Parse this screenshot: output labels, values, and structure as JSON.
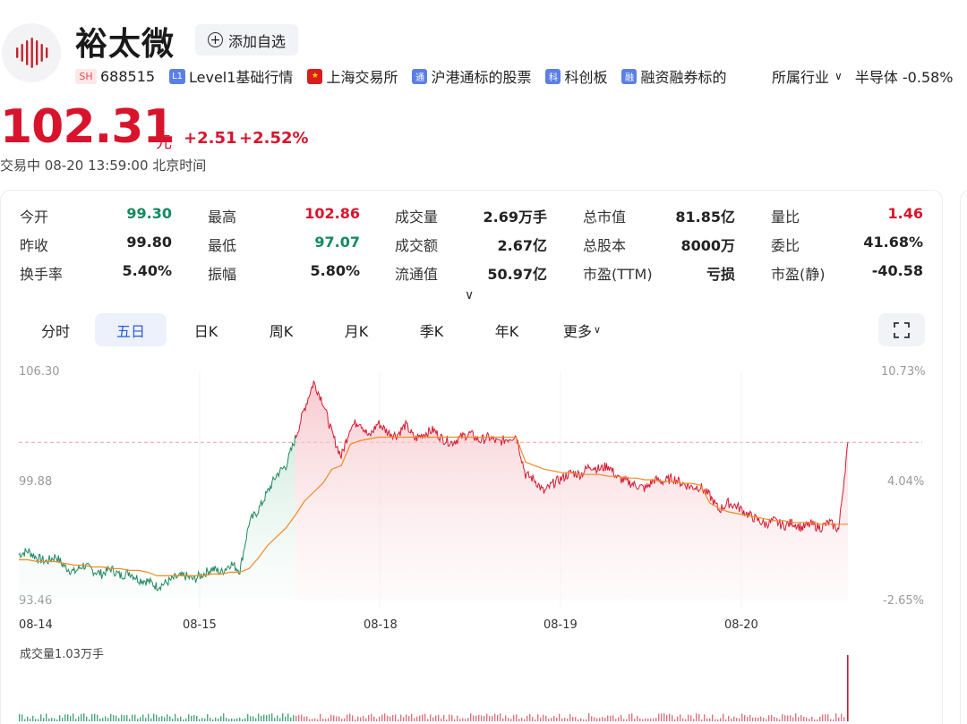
{
  "header": {
    "name": "裕太微",
    "watch_label": "添加自选",
    "tags": [
      {
        "badge": "SH",
        "text": "688515"
      },
      {
        "badge": "L1",
        "text": "Level1基础行情"
      },
      {
        "badge": "★",
        "text": "上海交易所"
      },
      {
        "badge": "通",
        "text": "沪港通标的股票"
      },
      {
        "badge": "科",
        "text": "科创板"
      },
      {
        "badge": "融",
        "text": "融资融券标的"
      }
    ],
    "industry_label": "所属行业",
    "industry_value": "半导体 -0.58%"
  },
  "quote": {
    "price": "102.31",
    "unit": "元",
    "change": "+2.51",
    "change_pct": "+2.52%",
    "status": "交易中 08-20 13:59:00 北京时间"
  },
  "stats": [
    [
      {
        "label": "今开",
        "value": "99.30",
        "tone": "down"
      },
      {
        "label": "最高",
        "value": "102.86",
        "tone": "up"
      },
      {
        "label": "成交量",
        "value": "2.69万手",
        "tone": ""
      },
      {
        "label": "总市值",
        "value": "81.85亿",
        "tone": ""
      },
      {
        "label": "量比",
        "value": "1.46",
        "tone": "up"
      }
    ],
    [
      {
        "label": "昨收",
        "value": "99.80",
        "tone": ""
      },
      {
        "label": "最低",
        "value": "97.07",
        "tone": "down"
      },
      {
        "label": "成交额",
        "value": "2.67亿",
        "tone": ""
      },
      {
        "label": "总股本",
        "value": "8000万",
        "tone": ""
      },
      {
        "label": "委比",
        "value": "41.68%",
        "tone": ""
      }
    ],
    [
      {
        "label": "换手率",
        "value": "5.40%",
        "tone": ""
      },
      {
        "label": "振幅",
        "value": "5.80%",
        "tone": ""
      },
      {
        "label": "流通值",
        "value": "50.97亿",
        "tone": ""
      },
      {
        "label": "市盈(TTM)",
        "value": "亏损",
        "tone": ""
      },
      {
        "label": "市盈(静)",
        "value": "-40.58",
        "tone": ""
      }
    ]
  ],
  "tabs": [
    "分时",
    "五日",
    "日K",
    "周K",
    "月K",
    "季K",
    "年K",
    "更多"
  ],
  "active_tab": 1,
  "chart_data": {
    "type": "line",
    "title": "",
    "x_ticks": [
      "08-14",
      "08-15",
      "08-18",
      "08-19",
      "08-20"
    ],
    "y_left_ticks": [
      "106.30",
      "99.88",
      "93.46"
    ],
    "y_right_ticks": [
      "10.73%",
      "4.04%",
      "-2.65%"
    ],
    "ylim": [
      93.46,
      106.3
    ],
    "reference_price": 102.31,
    "volume_label": "成交量1.03万手",
    "series": [
      {
        "name": "",
        "values": [
          96.0,
          96.2,
          95.8,
          95.6,
          95.9,
          95.3,
          95.0,
          95.4,
          95.1,
          94.9,
          95.2,
          94.8,
          95.0,
          94.6,
          94.5,
          94.2,
          94.4,
          94.7,
          94.8,
          94.6,
          94.9,
          95.2,
          95.0,
          95.5,
          95.1,
          97.8,
          98.5,
          99.5,
          100.5,
          101.0,
          102.5,
          104.2,
          105.7,
          104.6,
          102.8,
          101.5,
          103.2,
          103.5,
          102.6,
          103.4,
          102.9,
          102.7,
          103.3,
          102.5,
          102.8,
          103.0,
          102.5,
          102.3,
          102.6,
          102.8,
          102.4,
          102.6,
          102.3,
          102.5,
          102.7,
          100.5,
          100.2,
          99.5,
          100.0,
          100.3,
          100.6,
          100.5,
          101.0,
          100.8,
          101.0,
          100.3,
          100.1,
          99.9,
          99.7,
          100.2,
          100.1,
          100.3,
          100.0,
          99.8,
          99.8,
          99.3,
          98.5,
          98.9,
          98.7,
          98.3,
          98.0,
          97.7,
          97.9,
          97.6,
          97.8,
          97.5,
          97.7,
          97.5,
          97.8,
          97.4,
          102.31
        ]
      },
      {
        "name": "",
        "values": [
          95.7,
          95.7,
          95.6,
          95.6,
          95.6,
          95.5,
          95.4,
          95.4,
          95.3,
          95.3,
          95.2,
          95.2,
          95.1,
          95.1,
          95.0,
          94.8,
          94.8,
          94.8,
          94.8,
          94.8,
          94.8,
          94.9,
          94.9,
          95.0,
          95.0,
          95.2,
          95.8,
          96.5,
          97.0,
          97.5,
          98.2,
          99.0,
          99.5,
          100.0,
          100.8,
          101.0,
          102.2,
          102.4,
          102.5,
          102.6,
          102.6,
          102.6,
          102.6,
          102.6,
          102.6,
          102.6,
          102.6,
          102.6,
          102.6,
          102.6,
          102.6,
          102.6,
          102.6,
          102.6,
          102.6,
          101.2,
          101.0,
          100.8,
          100.7,
          100.6,
          100.6,
          100.5,
          100.5,
          100.5,
          100.4,
          100.4,
          100.3,
          100.3,
          100.2,
          100.2,
          100.1,
          100.1,
          100.0,
          100.0,
          99.9,
          98.9,
          98.6,
          98.4,
          98.3,
          98.2,
          98.1,
          98.0,
          97.9,
          97.9,
          97.8,
          97.8,
          97.8,
          97.7,
          97.7,
          97.7,
          97.7
        ]
      }
    ]
  }
}
